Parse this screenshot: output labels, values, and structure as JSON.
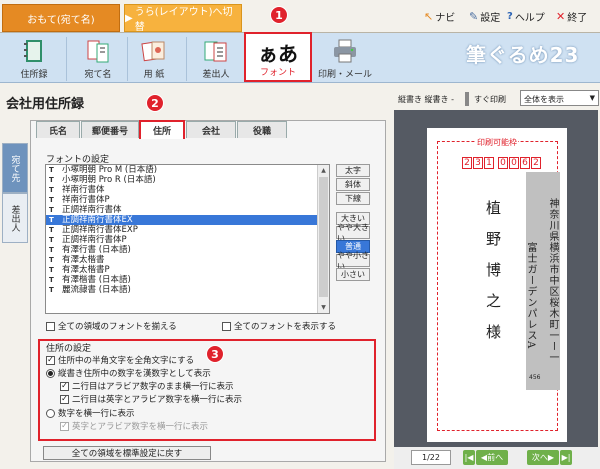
{
  "top": {
    "tab_front": "おもて(宛て名)",
    "tab_back": "うら(レイアウト)へ切替",
    "navi": "ナビ",
    "settings": "設定",
    "help": "ヘルプ",
    "quit": "終了"
  },
  "ribbon": {
    "items": [
      "住所録",
      "宛て名",
      "用 紙",
      "差出人",
      "フォント",
      "印刷・メール"
    ],
    "font_glyph": "ぁあ",
    "logo": "筆ぐるめ23"
  },
  "left": {
    "title": "会社用住所録",
    "categories": [
      "宛て先",
      "差出人"
    ],
    "tabs": [
      "氏名",
      "郵便番号",
      "住所",
      "会社",
      "役職"
    ],
    "font_section": "フォントの設定",
    "fonts": [
      "小塚明朝 Pro M (日本語)",
      "小塚明朝 Pro R (日本語)",
      "祥南行書体",
      "祥南行書体P",
      "正調祥南行書体",
      "正調祥南行書体EX",
      "正調祥南行書体EXP",
      "正調祥南行書体P",
      "有澤行書 (日本語)",
      "有澤太楷書",
      "有澤太楷書P",
      "有澤楷書 (日本語)",
      "麗流隷書 (日本語)"
    ],
    "selected_font": 5,
    "style_buttons": [
      "太字",
      "斜体",
      "下線"
    ],
    "size_buttons": [
      "大きい",
      "やや大きい",
      "普通",
      "やや小さい",
      "小さい"
    ],
    "selected_size": 2,
    "chk_all_fonts_same": "全ての領域のフォントを揃える",
    "chk_show_all_fonts": "全てのフォントを表示する",
    "addr_section": "住所の設定",
    "opt_fullwidth": "住所中の半角文字を全角文字にする",
    "opt_kanji_num": "縦書き住所中の数字を漢数字として表示",
    "opt_row2_arabic": "二行目はアラビア数字のまま横一行に表示",
    "opt_row2_alnum": "二行目は英字とアラビア数字を横一行に表示",
    "opt_horizontal": "数字を横一行に表示",
    "opt_alnum_horizontal": "英字とアラビア数字を横一行に表示",
    "reset_button": "全ての領域を標準設定に戻す",
    "badges": [
      "1",
      "2",
      "3"
    ]
  },
  "right": {
    "toolbar_label": "縦書き 縦書き -",
    "quick_print": "すぐ印刷",
    "view_select": "全体を表示",
    "printable": "印刷可能枠",
    "zip": [
      "2",
      "3",
      "1",
      "0",
      "0",
      "6",
      "2"
    ],
    "address_line1": "神奈川県横浜市中区桜木町一ー一",
    "address_line2": "富士ガーデンパレスA",
    "address_num": "456",
    "name": "植野博之様",
    "page": "1/22",
    "prev": "前へ",
    "next": "次へ"
  },
  "colors": {
    "accent_red": "#e0222c",
    "tab_orange": "#e58a23",
    "ribbon_blue": "#cfe1f2",
    "select_blue": "#3877d8"
  }
}
